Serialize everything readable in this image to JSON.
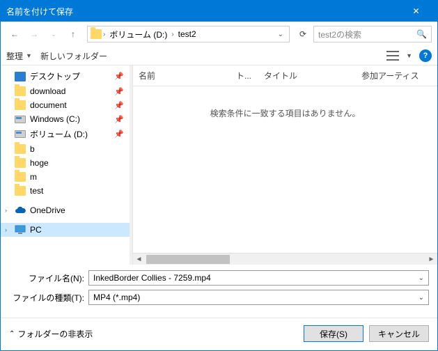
{
  "title": "名前を付けて保存",
  "breadcrumb": {
    "seg1": "ボリューム (D:)",
    "seg2": "test2"
  },
  "search_placeholder": "test2の検索",
  "toolbar": {
    "organize": "整理",
    "newfolder": "新しいフォルダー"
  },
  "tree": [
    {
      "label": "デスクトップ",
      "icon": "blue",
      "pin": true
    },
    {
      "label": "download",
      "icon": "folder",
      "pin": true
    },
    {
      "label": "document",
      "icon": "folder",
      "pin": true
    },
    {
      "label": "Windows (C:)",
      "icon": "drive",
      "pin": true
    },
    {
      "label": "ボリューム (D:)",
      "icon": "drive",
      "pin": true
    },
    {
      "label": "b",
      "icon": "folder",
      "pin": false
    },
    {
      "label": "hoge",
      "icon": "folder",
      "pin": false
    },
    {
      "label": "m",
      "icon": "folder",
      "pin": false
    },
    {
      "label": "test",
      "icon": "folder",
      "pin": false
    },
    {
      "label": "OneDrive",
      "icon": "cloud",
      "pin": false,
      "chev": true
    },
    {
      "label": "PC",
      "icon": "pc",
      "pin": false,
      "chev": true,
      "selected": true
    }
  ],
  "columns": {
    "name": "名前",
    "track": "ト...",
    "title": "タイトル",
    "artist": "参加アーティス"
  },
  "empty_msg": "検索条件に一致する項目はありません。",
  "filename_label": "ファイル名(N):",
  "filetype_label": "ファイルの種類(T):",
  "filename_value": "InkedBorder Collies - 7259.mp4",
  "filetype_value": "MP4 (*.mp4)",
  "hide_folders": "フォルダーの非表示",
  "save_btn": "保存(S)",
  "cancel_btn": "キャンセル"
}
